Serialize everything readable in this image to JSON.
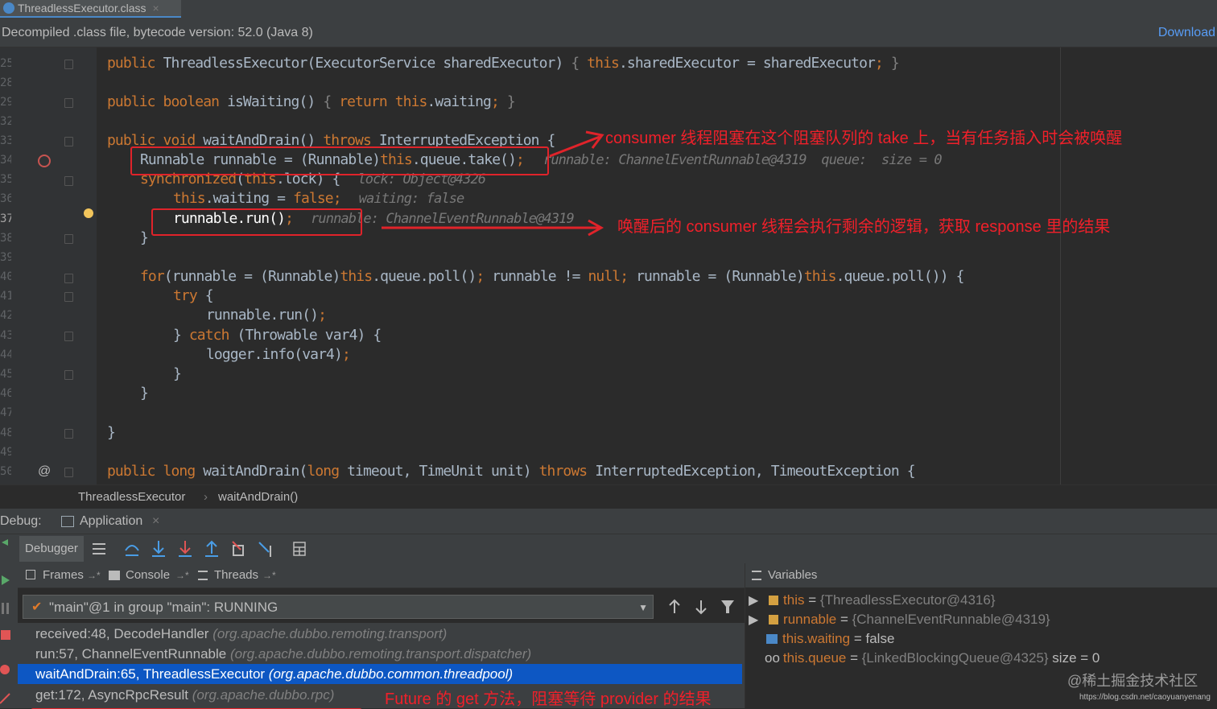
{
  "tab": {
    "title": "ThreadlessExecutor.class",
    "close": "×"
  },
  "banner": {
    "text": "Decompiled .class file, bytecode version: 52.0 (Java 8)",
    "download": "Download"
  },
  "gutter_lines": [
    "25",
    "28",
    "29",
    "32",
    "33",
    "34",
    "35",
    "36",
    "37",
    "38",
    "39",
    "40",
    "41",
    "42",
    "43",
    "44",
    "45",
    "46",
    "47",
    "48",
    "49",
    "50"
  ],
  "code": {
    "l25": {
      "kw": "public ",
      "name": "ThreadlessExecutor",
      "rest1": "(ExecutorService sharedExecutor) ",
      "b1": "{ ",
      "th": "this",
      "rest2": ".sharedExecutor = sharedExecutor",
      "semi": ";",
      "b2": " }"
    },
    "l29": {
      "kw": "public boolean ",
      "name": "isWaiting",
      "rest1": "() ",
      "b1": "{ ",
      "kw2": "return ",
      "th": "this",
      "rest2": ".waiting",
      "semi": ";",
      "b2": " }"
    },
    "l33": {
      "kw": "public void ",
      "name": "waitAndDrain",
      "rest1": "() ",
      "kw2": "throws ",
      "rest2": "InterruptedException {"
    },
    "l34": {
      "a": "Runnable runnable = (Runnable)",
      "th": "this",
      "b": ".queue.take()",
      "semi": ";",
      "inline": "runnable: ChannelEventRunnable@4319  queue:  size = 0"
    },
    "l35": {
      "kw": "synchronized",
      "a": "(",
      "th": "this",
      "b": ".lock) {",
      "inline": "lock: Object@4326"
    },
    "l36": {
      "th": "this",
      "a": ".waiting = ",
      "kw": "false",
      "semi": ";",
      "inline": "waiting: false"
    },
    "l37": {
      "a": "runnable.run()",
      "semi": ";",
      "inline": "runnable: ChannelEventRunnable@4319"
    },
    "l38": {
      "a": "}"
    },
    "l40": {
      "kw": "for",
      "a": "(runnable = (Runnable)",
      "th1": "this",
      "b": ".queue.poll()",
      "semi1": "; ",
      "c": "runnable != ",
      "kw2": "null",
      "semi2": "; ",
      "d": "runnable = (Runnable)",
      "th2": "this",
      "e": ".queue.poll()) {"
    },
    "l41": {
      "kw": "try",
      "a": " {"
    },
    "l42": {
      "a": "runnable.run()",
      "semi": ";"
    },
    "l43": {
      "a": "} ",
      "kw": "catch",
      "b": " (Throwable var4) {"
    },
    "l44": {
      "a": "logger.info(var4)",
      "semi": ";"
    },
    "l45": {
      "a": "}"
    },
    "l46": {
      "a": "}"
    },
    "l48": {
      "a": "}"
    },
    "l50": {
      "kw": "public long ",
      "name": "waitAndDrain",
      "a": "(",
      "kw2": "long ",
      "b": "timeout, TimeUnit unit) ",
      "kw3": "throws ",
      "c": "InterruptedException, TimeoutException {"
    }
  },
  "gutter_markers": {
    "at": "@"
  },
  "annotations": {
    "a1": "consumer 线程阻塞在这个阻塞队列的 take 上，当有任务插入时会被唤醒",
    "a2": "唤醒后的 consumer 线程会执行剩余的逻辑，获取 response 里的结果",
    "a3": "Future 的 get 方法，阻塞等待 provider 的结果"
  },
  "breadcrumb": {
    "cls": "ThreadlessExecutor",
    "sep": "›",
    "method": "waitAndDrain()"
  },
  "debug": {
    "label": "Debug:",
    "config": "Application",
    "close": "×",
    "debugger_tab": "Debugger"
  },
  "panels": {
    "frames": "Frames",
    "console": "Console",
    "threads": "Threads",
    "variables": "Variables",
    "arrow": "→*"
  },
  "thread_select": {
    "value": "\"main\"@1 in group \"main\": RUNNING"
  },
  "frames": [
    {
      "method": "received:48, DecodeHandler",
      "pkg": "(org.apache.dubbo.remoting.transport)"
    },
    {
      "method": "run:57, ChannelEventRunnable",
      "pkg": "(org.apache.dubbo.remoting.transport.dispatcher)"
    },
    {
      "method": "waitAndDrain:65, ThreadlessExecutor",
      "pkg": "(org.apache.dubbo.common.threadpool)"
    },
    {
      "method": "get:172, AsyncRpcResult",
      "pkg": "(org.apache.dubbo.rpc)"
    }
  ],
  "variables": [
    {
      "name": "this",
      "eq": " = ",
      "value": "{ThreadlessExecutor@4316}",
      "extra": ""
    },
    {
      "name": "runnable",
      "eq": " = ",
      "value": "{ChannelEventRunnable@4319}",
      "extra": ""
    },
    {
      "name": "this.waiting",
      "eq": " = ",
      "value": "false",
      "extra": ""
    },
    {
      "name": "this.queue",
      "eq": " = ",
      "value": "{LinkedBlockingQueue@4325}",
      "extra": "  size = 0"
    }
  ],
  "watermark": {
    "text": "@稀土掘金技术社区",
    "url": "https://blog.csdn.net/caoyuanyenang"
  },
  "colors": {
    "accent": "#0d57c3",
    "annotation": "#f0202a",
    "keyword": "#cc7832",
    "field": "#9876aa"
  }
}
